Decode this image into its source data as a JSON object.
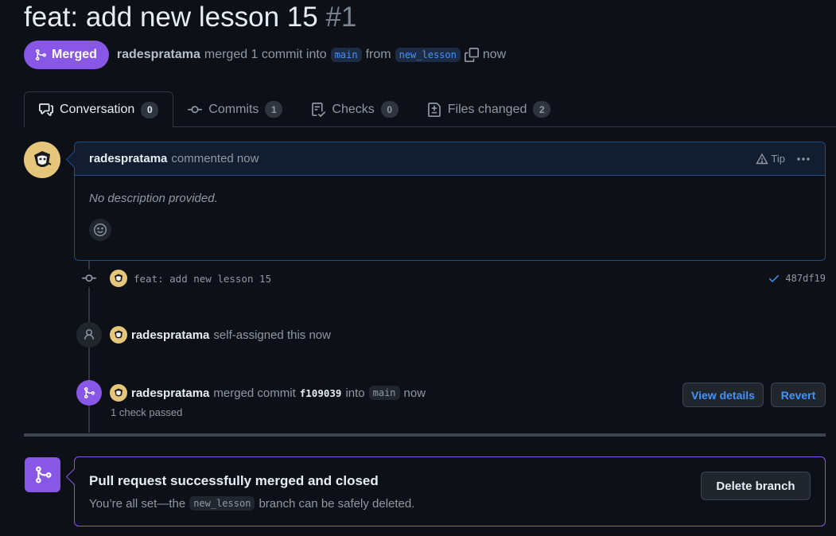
{
  "pr": {
    "title": "feat: add new lesson 15",
    "number": "#1",
    "state_label": "Merged",
    "author": "radespratama",
    "merged_text": "merged 1 commit into",
    "base_branch": "main",
    "from_text": "from",
    "head_branch": "new_lesson",
    "time": "now"
  },
  "tabs": [
    {
      "label": "Conversation",
      "count": "0",
      "icon": "comment-discussion-icon"
    },
    {
      "label": "Commits",
      "count": "1",
      "icon": "git-commit-icon"
    },
    {
      "label": "Checks",
      "count": "0",
      "icon": "checklist-icon"
    },
    {
      "label": "Files changed",
      "count": "2",
      "icon": "file-diff-icon"
    }
  ],
  "comment": {
    "author": "radespratama",
    "action": "commented now",
    "tip_label": "Tip",
    "body": "No description provided."
  },
  "timeline": {
    "commit": {
      "message": "feat: add new lesson 15",
      "sha": "487df19"
    },
    "assign": {
      "author": "radespratama",
      "text": "self-assigned this now"
    },
    "merge": {
      "author": "radespratama",
      "text": "merged commit",
      "sha": "f109039",
      "into": "into",
      "branch": "main",
      "time": "now",
      "checks": "1 check passed",
      "view_details_label": "View details",
      "revert_label": "Revert"
    }
  },
  "merge_box": {
    "title": "Pull request successfully merged and closed",
    "sub_prefix": "You’re all set—the",
    "branch": "new_lesson",
    "sub_suffix": "branch can be safely deleted.",
    "delete_label": "Delete branch"
  },
  "colors": {
    "merged": "#8957e5",
    "link": "#4493f8",
    "background": "#0d1117"
  }
}
